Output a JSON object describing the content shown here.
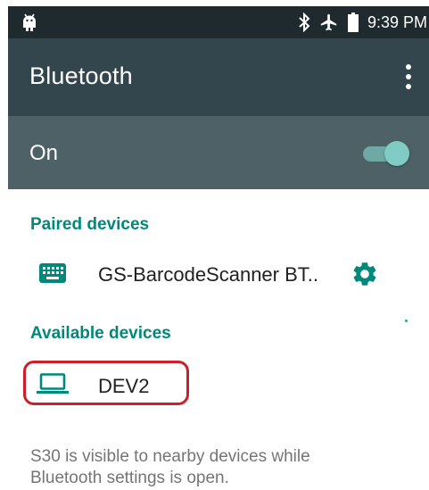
{
  "status_bar": {
    "time": "9:39 PM",
    "icons": [
      "android-icon",
      "bluetooth-icon",
      "airplane-icon",
      "battery-icon"
    ]
  },
  "toolbar": {
    "title": "Bluetooth",
    "menu_icon": "more-vert-icon"
  },
  "master_switch": {
    "label": "On",
    "checked": true
  },
  "paired": {
    "header": "Paired devices",
    "devices": [
      {
        "name": "GS-BarcodeScanner  BT..",
        "icon": "keyboard-icon",
        "settings_icon": "gear-icon"
      }
    ]
  },
  "available": {
    "header": "Available devices",
    "devices": [
      {
        "name": "DEV2",
        "icon": "laptop-icon"
      }
    ]
  },
  "footer": {
    "line1": "S30 is visible to nearby devices while",
    "line2": "Bluetooth settings is open."
  },
  "colors": {
    "status_bar": "#1e2a2e",
    "toolbar": "#34464d",
    "switch_bar": "#4e6167",
    "accent": "#00897b",
    "highlight": "#cc1f2a"
  }
}
